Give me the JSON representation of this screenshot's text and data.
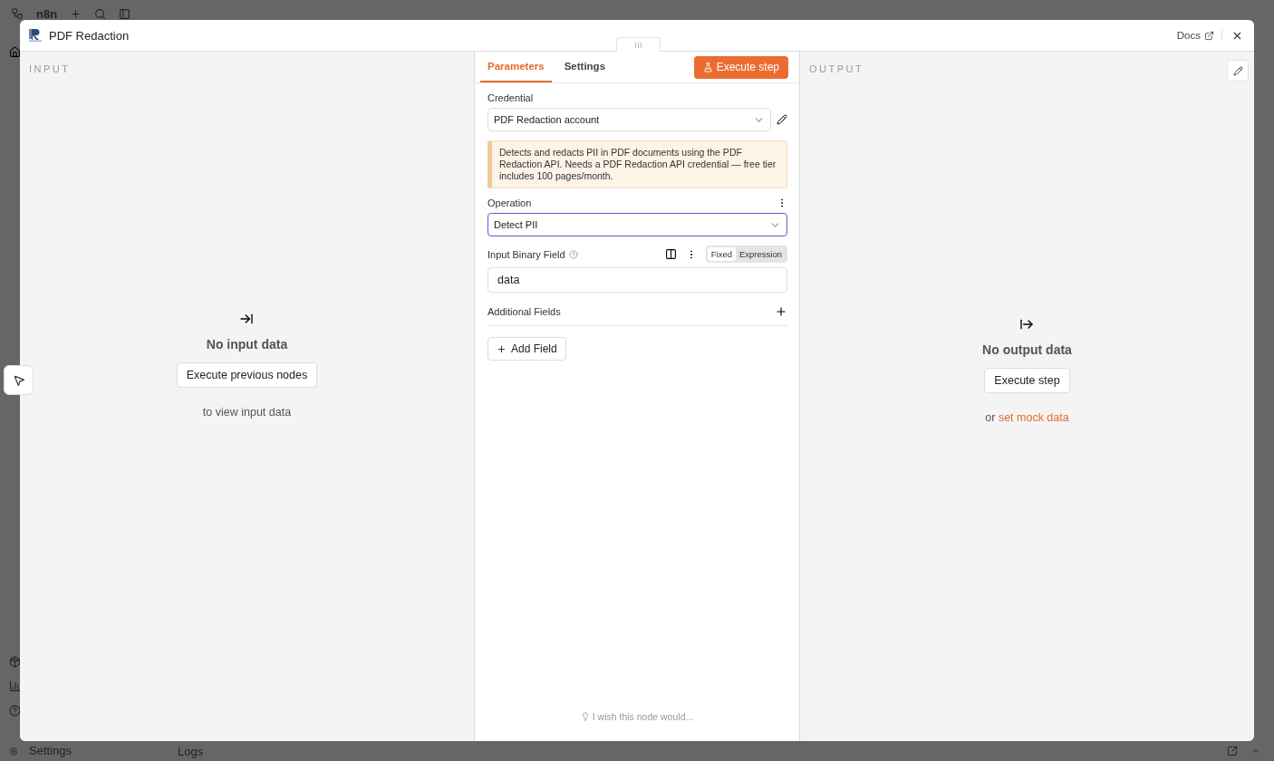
{
  "app": {
    "brand": "n8n",
    "sidebar_footer": "Settings",
    "bottom_tab": "Logs"
  },
  "modal": {
    "title": "PDF Redaction",
    "docs_link": "Docs"
  },
  "input_panel": {
    "heading": "INPUT",
    "empty_title": "No input data",
    "button": "Execute previous nodes",
    "hint": "to view input data"
  },
  "parameters_panel": {
    "tabs": [
      {
        "label": "Parameters",
        "selected": true
      },
      {
        "label": "Settings",
        "selected": false
      }
    ],
    "execute_button": "Execute step",
    "fields": [
      {
        "kind": "select",
        "label": "Credential",
        "value": "PDF Redaction account",
        "focused": false,
        "editable": true
      },
      {
        "kind": "notice",
        "text": "Detects and redacts PII in PDF documents using the PDF Redaction API. Needs a PDF Redaction API credential — free tier includes 100 pages/month."
      },
      {
        "kind": "select",
        "label": "Operation",
        "value": "Detect PII",
        "focused": true,
        "editable": false
      },
      {
        "kind": "text",
        "label": "Input Binary Field",
        "value": "data",
        "modes": [
          {
            "label": "Fixed",
            "selected": true
          },
          {
            "label": "Expression",
            "selected": false
          }
        ]
      },
      {
        "kind": "collection",
        "label": "Additional Fields",
        "button": "Add Field"
      }
    ],
    "feedback": "I wish this node would..."
  },
  "output_panel": {
    "heading": "OUTPUT",
    "empty_title": "No output data",
    "button": "Execute step",
    "hint_prefix": "or",
    "hint_link": "set mock data"
  }
}
